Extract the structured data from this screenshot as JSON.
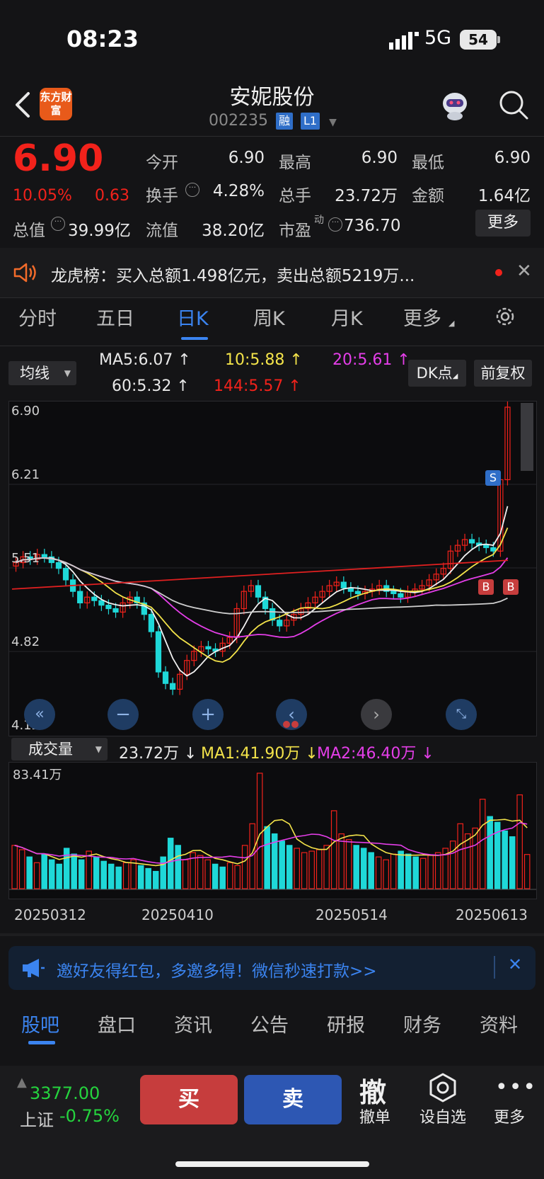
{
  "status": {
    "time": "08:23",
    "network": "5G",
    "battery": "54"
  },
  "header": {
    "logo": "东方财富",
    "title": "安妮股份",
    "code": "002235",
    "tag1": "融",
    "tag2": "L1"
  },
  "quote": {
    "price": "6.90",
    "change_pct": "10.05%",
    "change": "0.63",
    "open_label": "今开",
    "open": "6.90",
    "high_label": "最高",
    "high": "6.90",
    "low_label": "最低",
    "low": "6.90",
    "turnover_label": "换手",
    "turnover": "4.28%",
    "volume_label": "总手",
    "volume": "23.72万",
    "amount_label": "金额",
    "amount": "1.64亿",
    "mktcap_label": "总值",
    "mktcap": "39.99亿",
    "float_label": "流值",
    "float": "38.20亿",
    "pe_label": "市盈",
    "pe_sup": "动",
    "pe": "736.70",
    "more": "更多"
  },
  "notice": {
    "text": "龙虎榜：买入总额1.498亿元，卖出总额5219万..."
  },
  "tabs": [
    "分时",
    "五日",
    "日K",
    "周K",
    "月K",
    "更多"
  ],
  "kline": {
    "indicator": "均线",
    "ma5": "MA5:6.07",
    "ma10": "10:5.88",
    "ma20": "20:5.61",
    "ma60": "60:5.32",
    "ma144": "144:5.57",
    "dk_button": "DK点",
    "adjust_button": "前复权",
    "y_labels": [
      "6.90",
      "6.21",
      "5.51",
      "4.82",
      "4.12"
    ],
    "s_marker": "S",
    "b_marker": "B"
  },
  "volume": {
    "indicator": "成交量",
    "vol": "23.72万",
    "ma1": "MA1:41.90万",
    "ma2": "MA2:46.40万",
    "max_label": "83.41万",
    "dates": [
      "20250312",
      "20250410",
      "20250514",
      "20250613"
    ]
  },
  "invite": {
    "text": "邀好友得红包，多邀多得！微信秒速打款>>"
  },
  "bottom_tabs": [
    "股吧",
    "盘口",
    "资讯",
    "公告",
    "研报",
    "财务",
    "资料"
  ],
  "bottom": {
    "index_value": "3377.00",
    "index_name": "上证",
    "index_change": "-0.75%",
    "buy": "买",
    "sell": "卖",
    "cancel_glyph": "撤",
    "cancel": "撤单",
    "watch": "设自选",
    "more": "更多"
  },
  "colors": {
    "up": "#f2221b",
    "down": "#1fd8d8",
    "accent": "#3b84f0"
  }
}
